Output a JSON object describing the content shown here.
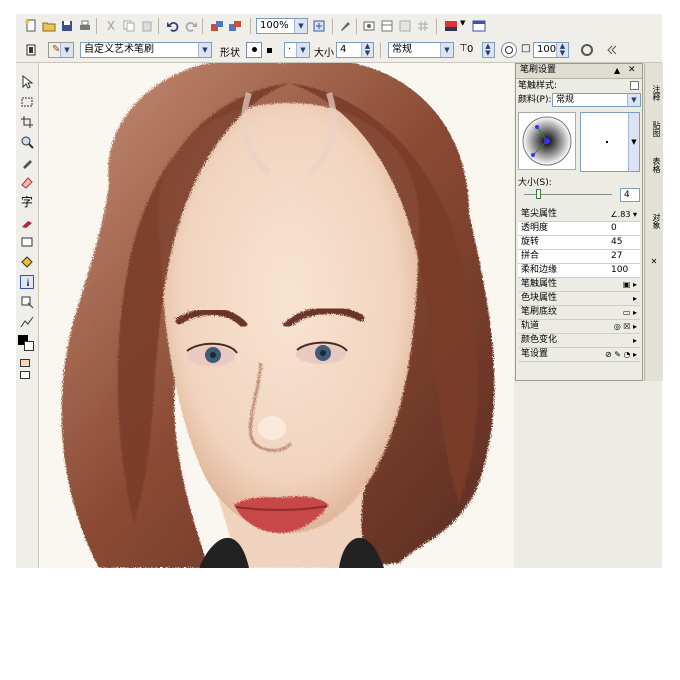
{
  "toolbar": {
    "zoom_value": "100%",
    "brush_category": "自定义艺术笔刷",
    "shape_label": "形状",
    "size_label": "大小",
    "size_value": "4",
    "mode_value": "常规",
    "opacity_value": "0",
    "strength_value": "100"
  },
  "panel": {
    "title": "笔刷设置",
    "brush_style_label": "笔触样式:",
    "media_label": "颜料(P):",
    "media_value": "常规",
    "size_label": "大小(S):",
    "size_value": "4",
    "properties": [
      {
        "type": "category",
        "label": "笔尖属性",
        "icon": "∠.83 ▾"
      },
      {
        "type": "value",
        "label": "透明度",
        "value": "0"
      },
      {
        "type": "value",
        "label": "旋转",
        "value": "45"
      },
      {
        "type": "value",
        "label": "拼合",
        "value": "27"
      },
      {
        "type": "value",
        "label": "柔和边缘",
        "value": "100"
      },
      {
        "type": "category",
        "label": "笔触属性",
        "icon": "▣ ▸"
      },
      {
        "type": "category",
        "label": "色块属性",
        "icon": "▸"
      },
      {
        "type": "category",
        "label": "笔刷底纹",
        "icon": "▭ ▸"
      },
      {
        "type": "category",
        "label": "轨道",
        "icon": "◎ ☒ ▸"
      },
      {
        "type": "category",
        "label": "颜色变化",
        "icon": "▸"
      },
      {
        "type": "category",
        "label": "笔设置",
        "icon": "⊘ ✎ ◔ ▸"
      }
    ]
  },
  "side_tabs": [
    "注释",
    "贴图",
    "表格",
    "对象"
  ],
  "colors": {
    "toolbar_bg": "#efeee8",
    "skin": "#f3dac6",
    "hair": "#8a4a33",
    "lips": "#c8464a",
    "eyes": "#3e5b78"
  }
}
